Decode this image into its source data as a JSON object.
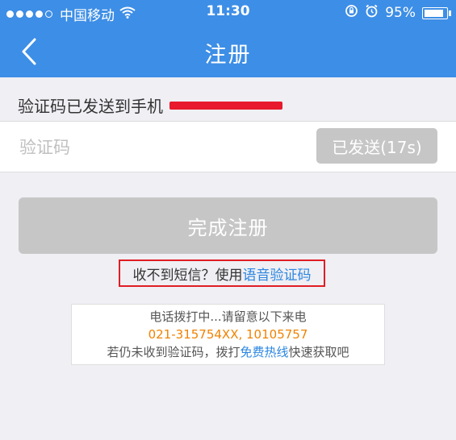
{
  "status_bar": {
    "carrier": "中国移动",
    "time": "11:30",
    "battery": "95%",
    "battery_level": 0.95
  },
  "header": {
    "title": "注册",
    "back_icon": "chevron-left-icon"
  },
  "verify": {
    "sent_label": "验证码已发送到手机",
    "code_placeholder": "验证码",
    "resend_label": "已发送(17s)"
  },
  "submit": {
    "label": "完成注册"
  },
  "voice_hint": {
    "prefix": "收不到短信？使用",
    "link": "语音验证码"
  },
  "notice": {
    "line1": "电话拨打中...请留意以下来电",
    "phones": "021-315754XX, 10105757",
    "line3_prefix": "若仍未收到验证码，拨打",
    "hotline_link": "免费热线",
    "line3_suffix": "快速获取吧"
  },
  "colors": {
    "header_bg": "#3d8ee6",
    "link": "#2b86e0",
    "phone_text": "#f08200",
    "highlight_border": "#e01d24",
    "disabled_button": "#c6c6c6"
  }
}
